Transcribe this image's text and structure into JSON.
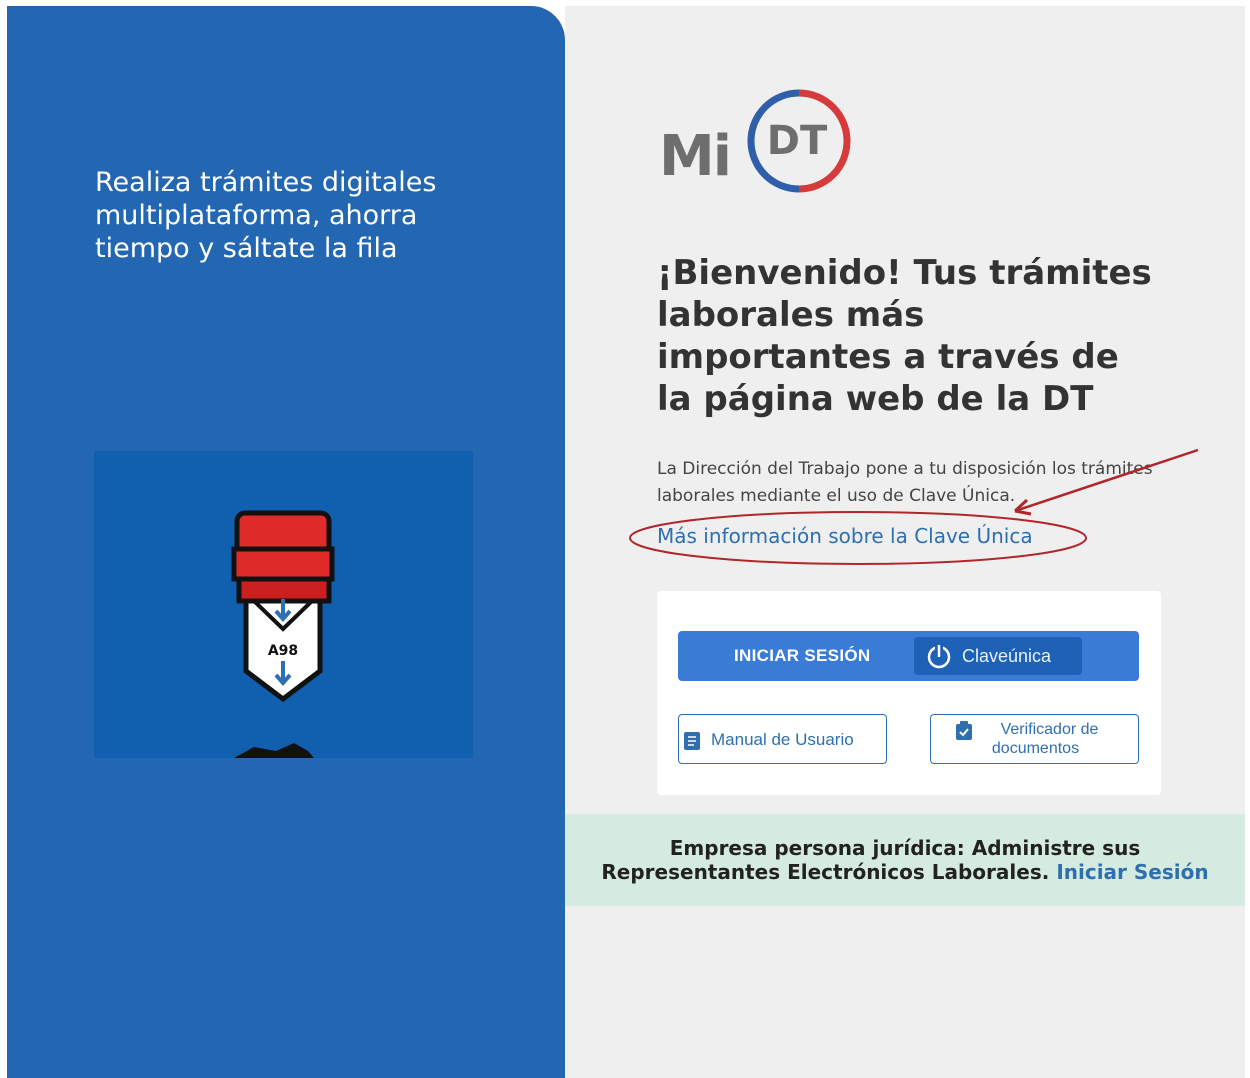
{
  "left": {
    "tagline": "Realiza trámites digitales multiplataforma, ahorra tiempo y sáltate la fila",
    "ticket_number": "A98"
  },
  "logo": {
    "mi": "Mi",
    "dt": "DT"
  },
  "main": {
    "welcome": "¡Bienvenido! Tus trámites laborales más importantes a través de la página web de la DT",
    "description": "La Dirección del Trabajo pone a tu disposición los trámites laborales mediante el uso de Clave Única.",
    "more_info_link": "Más información sobre la Clave Única"
  },
  "login": {
    "login_label": "INICIAR SESIÓN",
    "clave_unica": "Claveúnica",
    "manual_label": "Manual de Usuario",
    "verifier_line1": "Verificador de",
    "verifier_line2": "documentos"
  },
  "company": {
    "line1": "Empresa persona jurídica: Administre sus",
    "line2": "Representantes Electrónicos Laborales.",
    "signin_link": "Iniciar Sesión"
  },
  "colors": {
    "left_panel": "#2367b3",
    "primary_button": "#3a7bd5",
    "link": "#2f6fb0",
    "banner": "#d6ebe0",
    "annotation": "#b0262a"
  },
  "icons": [
    "clave-unica-power-icon",
    "book-icon",
    "clipboard-check-icon"
  ]
}
